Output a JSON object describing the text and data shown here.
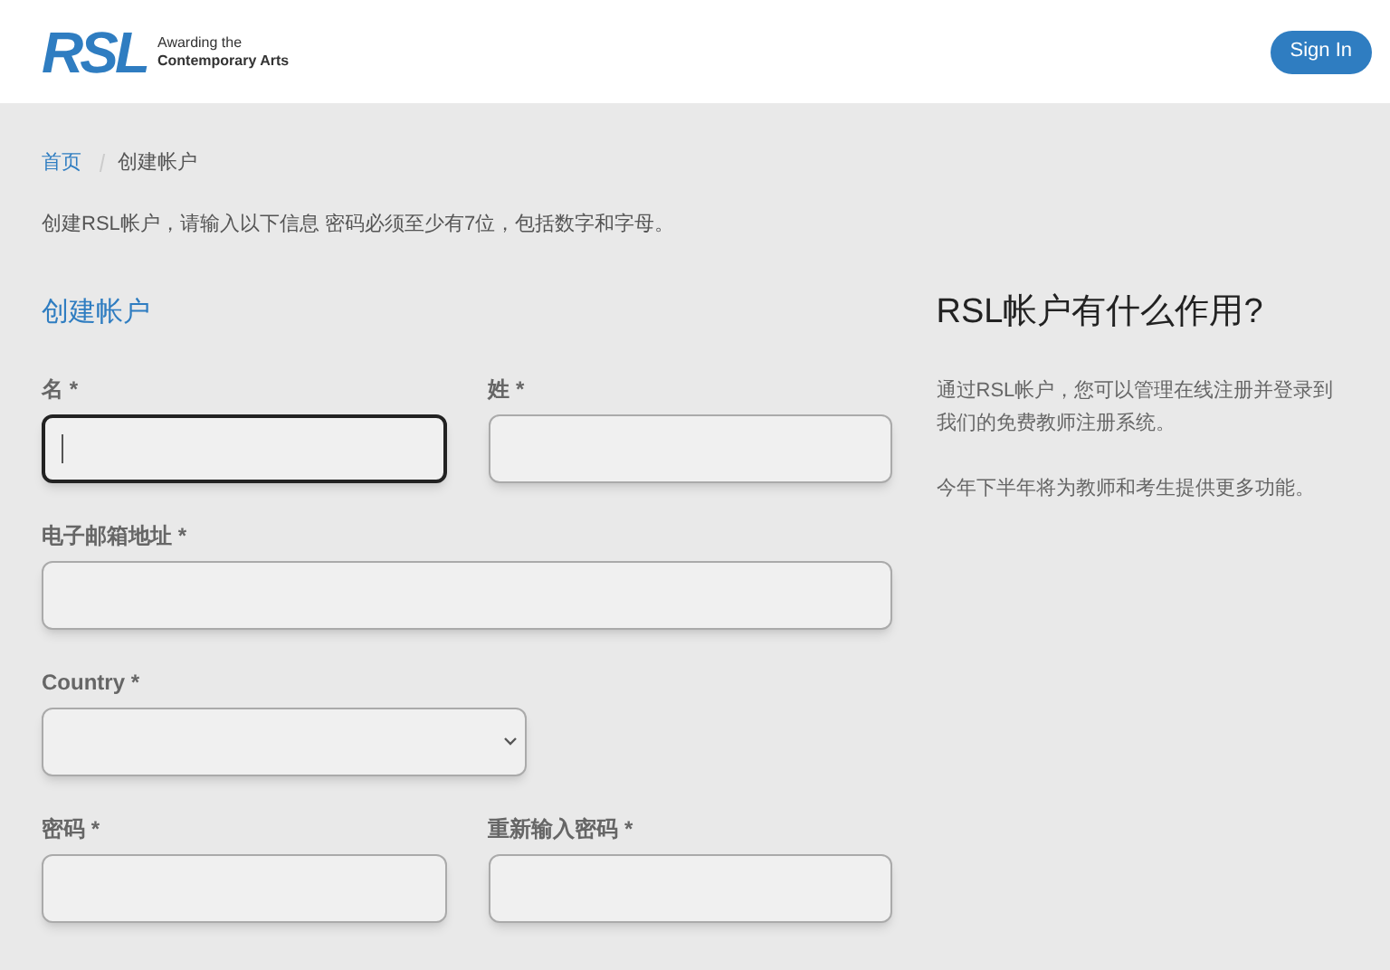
{
  "header": {
    "logo": {
      "mark": "RSL",
      "tagline_1": "Awarding the",
      "tagline_2": "Contemporary Arts"
    },
    "sign_in": "Sign In"
  },
  "breadcrumb": [
    {
      "label": "首页",
      "kind": "link"
    },
    {
      "label": "创建帐户",
      "kind": "current"
    }
  ],
  "intro": "创建RSL帐户，请输入以下信息 密码必须至少有7位，包括数字和字母。",
  "form": {
    "title": "创建帐户",
    "rows": [
      [
        {
          "label": "名 *",
          "kind": "text",
          "focused": true
        },
        {
          "label": "姓 *",
          "kind": "text",
          "focused": false
        }
      ],
      [
        {
          "label": "电子邮箱地址 *",
          "kind": "text",
          "focused": false
        }
      ],
      [
        {
          "label": "Country *",
          "kind": "select",
          "focused": false
        }
      ],
      [
        {
          "label": "密码 *",
          "kind": "text",
          "focused": false
        },
        {
          "label": "重新输入密码 *",
          "kind": "text",
          "focused": false
        }
      ]
    ]
  },
  "aside": {
    "title": "RSL帐户有什么作用?",
    "paragraphs": [
      "通过RSL帐户，您可以管理在线注册并登录到我们的免费教师注册系统。",
      "今年下半年将为教师和考生提供更多功能。"
    ]
  }
}
